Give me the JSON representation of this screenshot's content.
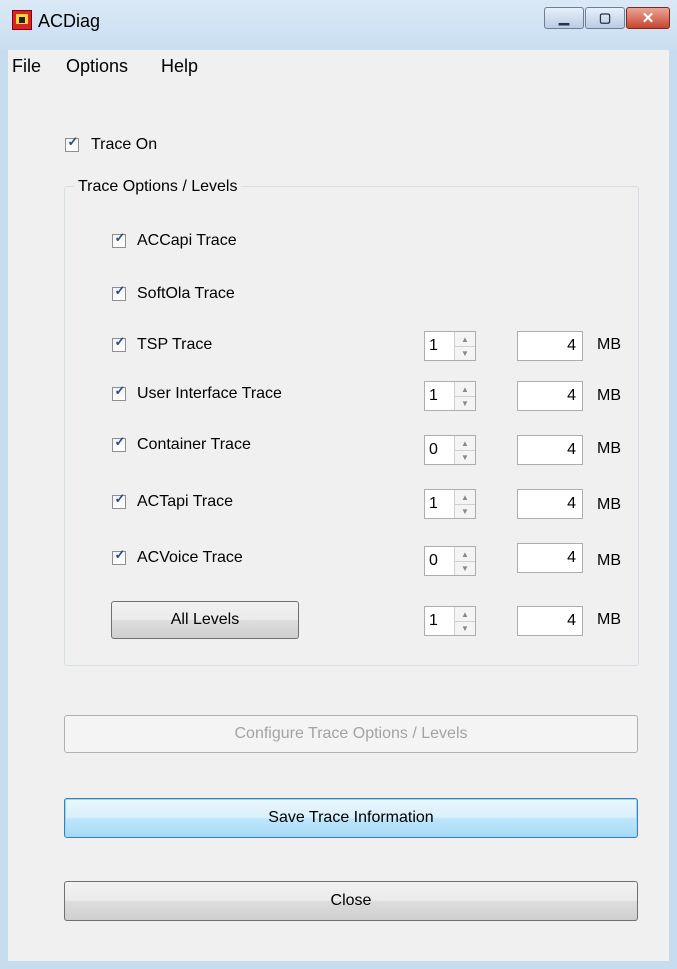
{
  "window": {
    "title": "ACDiag"
  },
  "menu": [
    "File",
    "Options",
    "Help"
  ],
  "trace_on": {
    "label": "Trace On",
    "checked": true
  },
  "group": {
    "title": "Trace Options / Levels",
    "traces": [
      {
        "label": "ACCapi Trace",
        "checked": true
      },
      {
        "label": "SoftOla Trace",
        "checked": true
      },
      {
        "label": "TSP Trace",
        "checked": true,
        "level": "1",
        "size": "4",
        "unit": "MB"
      },
      {
        "label": "User Interface Trace",
        "checked": true,
        "level": "1",
        "size": "4",
        "unit": "MB"
      },
      {
        "label": "Container Trace",
        "checked": true,
        "level": "0",
        "size": "4",
        "unit": "MB"
      },
      {
        "label": "ACTapi Trace",
        "checked": true,
        "level": "1",
        "size": "4",
        "unit": "MB"
      },
      {
        "label": "ACVoice Trace",
        "checked": true,
        "level": "0",
        "size": "4",
        "unit": "MB"
      }
    ],
    "all_levels": {
      "label": "All Levels",
      "level": "1",
      "size": "4",
      "unit": "MB"
    }
  },
  "buttons": {
    "configure": "Configure Trace Options / Levels",
    "save": "Save Trace Information",
    "close": "Close"
  },
  "colors": {
    "titlebar": "#c9def1",
    "face": "#f0f0f0",
    "close_button": "#c7462f",
    "check": "#2a4f85"
  }
}
